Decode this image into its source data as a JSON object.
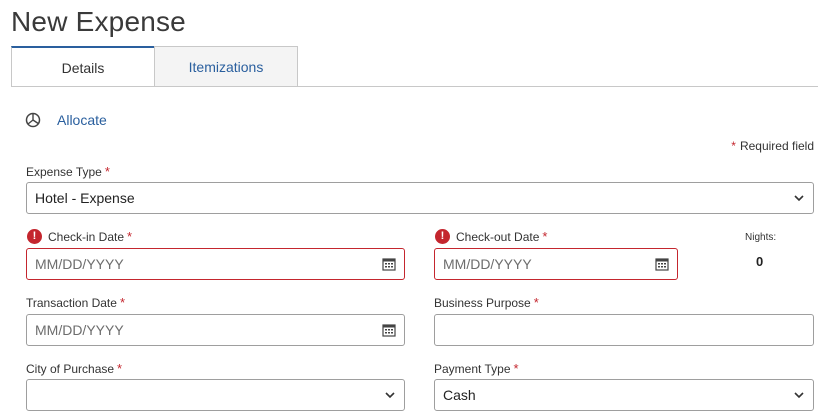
{
  "page": {
    "title": "New Expense"
  },
  "tabs": [
    {
      "label": "Details"
    },
    {
      "label": "Itemizations"
    }
  ],
  "allocate": {
    "label": "Allocate"
  },
  "required_note": {
    "star": "*",
    "text": "Required field"
  },
  "required_star": "*",
  "fields": {
    "expense_type": {
      "label": "Expense Type",
      "value": "Hotel - Expense"
    },
    "checkin_date": {
      "label": "Check-in Date",
      "placeholder": "MM/DD/YYYY"
    },
    "checkout_date": {
      "label": "Check-out Date",
      "placeholder": "MM/DD/YYYY"
    },
    "nights": {
      "label": "Nights:",
      "value": "0"
    },
    "transaction_date": {
      "label": "Transaction Date",
      "placeholder": "MM/DD/YYYY"
    },
    "business_purpose": {
      "label": "Business Purpose",
      "value": ""
    },
    "city_of_purchase": {
      "label": "City of Purchase",
      "value": ""
    },
    "payment_type": {
      "label": "Payment Type",
      "value": "Cash"
    }
  },
  "icons": {
    "error": "error-icon",
    "calendar": "calendar-icon",
    "chevron": "chevron-down-icon",
    "allocate": "pie-chart-icon"
  },
  "colors": {
    "accent": "#2a5f9e",
    "error": "#c4262e",
    "border": "#9e9e9e"
  }
}
